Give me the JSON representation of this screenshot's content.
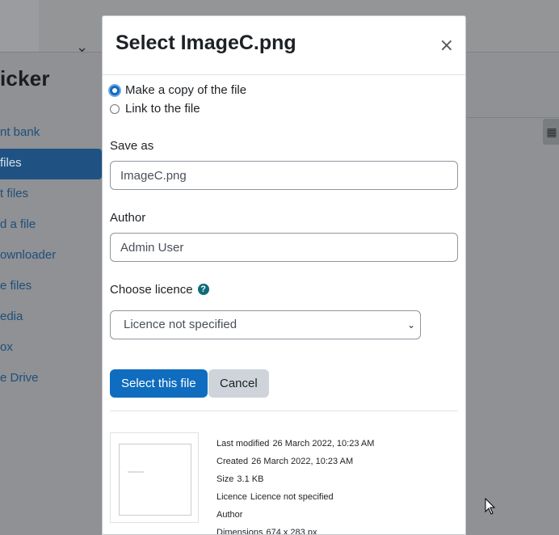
{
  "background": {
    "heading": "icker",
    "chevron": "chevron-down-icon",
    "sidebar": [
      "nt bank",
      " files",
      "t files",
      "d a file",
      "ownloader",
      "e files",
      "edia",
      "ox",
      "e Drive"
    ],
    "view_icon": "grid-icon"
  },
  "dialog": {
    "title": "Select ImageC.png",
    "close_icon": "close-icon",
    "options": {
      "copy": "Make a copy of the file",
      "link": "Link to the file",
      "selected": "copy"
    },
    "save_as": {
      "label": "Save as",
      "value": "ImageC.png"
    },
    "author": {
      "label": "Author",
      "value": "Admin User"
    },
    "licence": {
      "label": "Choose licence",
      "selected": "Licence not specified"
    },
    "buttons": {
      "select": "Select this file",
      "cancel": "Cancel"
    },
    "details": {
      "last_modified": {
        "label": "Last modified",
        "value": "26 March 2022, 10:23 AM"
      },
      "created": {
        "label": "Created",
        "value": "26 March 2022, 10:23 AM"
      },
      "size": {
        "label": "Size",
        "value": "3.1 KB"
      },
      "licence": {
        "label": "Licence",
        "value": "Licence not specified"
      },
      "author": {
        "label": "Author",
        "value": ""
      },
      "dimensions": {
        "label": "Dimensions",
        "value": "674 x 283 px"
      }
    }
  },
  "colors": {
    "primary": "#0f6cbf",
    "overlay": "#8f9194",
    "help": "#0f6b7a"
  }
}
